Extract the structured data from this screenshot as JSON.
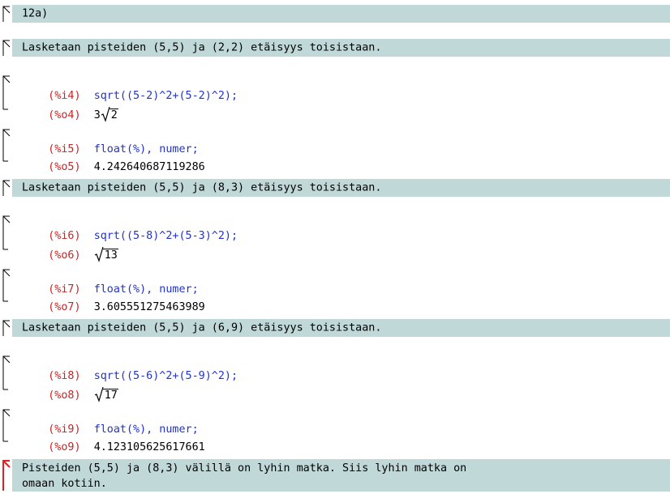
{
  "colors": {
    "text_band": "#c0d8d8",
    "input_label": "#cc2222",
    "input_code": "#2233cc",
    "output": "#000000",
    "active_bracket": "#dd2222"
  },
  "cells": {
    "title": {
      "text": "12a)"
    },
    "text1": {
      "text": "Lasketaan pisteiden (5,5) ja (2,2) etäisyys toisistaan."
    },
    "g1": {
      "in_label": "(%i4)",
      "in_code": "sqrt((5-2)^2+(5-2)^2);",
      "out_label": "(%o4)",
      "out_coef": "3",
      "out_radicand": "2"
    },
    "g2": {
      "in_label": "(%i5)",
      "in_code": "float(%), numer;",
      "out_label": "(%o5)",
      "out_value": "4.242640687119286"
    },
    "text2": {
      "text": "Lasketaan pisteiden (5,5) ja (8,3) etäisyys toisistaan."
    },
    "g3": {
      "in_label": "(%i6)",
      "in_code": "sqrt((5-8)^2+(5-3)^2);",
      "out_label": "(%o6)",
      "out_radicand": "13"
    },
    "g4": {
      "in_label": "(%i7)",
      "in_code": "float(%), numer;",
      "out_label": "(%o7)",
      "out_value": "3.605551275463989"
    },
    "text3": {
      "text": "Lasketaan pisteiden (5,5) ja (6,9) etäisyys toisistaan."
    },
    "g5": {
      "in_label": "(%i8)",
      "in_code": "sqrt((5-6)^2+(5-9)^2);",
      "out_label": "(%o8)",
      "out_radicand": "17"
    },
    "g6": {
      "in_label": "(%i9)",
      "in_code": "float(%), numer;",
      "out_label": "(%o9)",
      "out_value": "4.123105625617661"
    },
    "text4": {
      "text": "Pisteiden (5,5) ja (8,3) välillä on lyhin matka. Siis lyhin matka on\nomaan kotiin."
    }
  }
}
